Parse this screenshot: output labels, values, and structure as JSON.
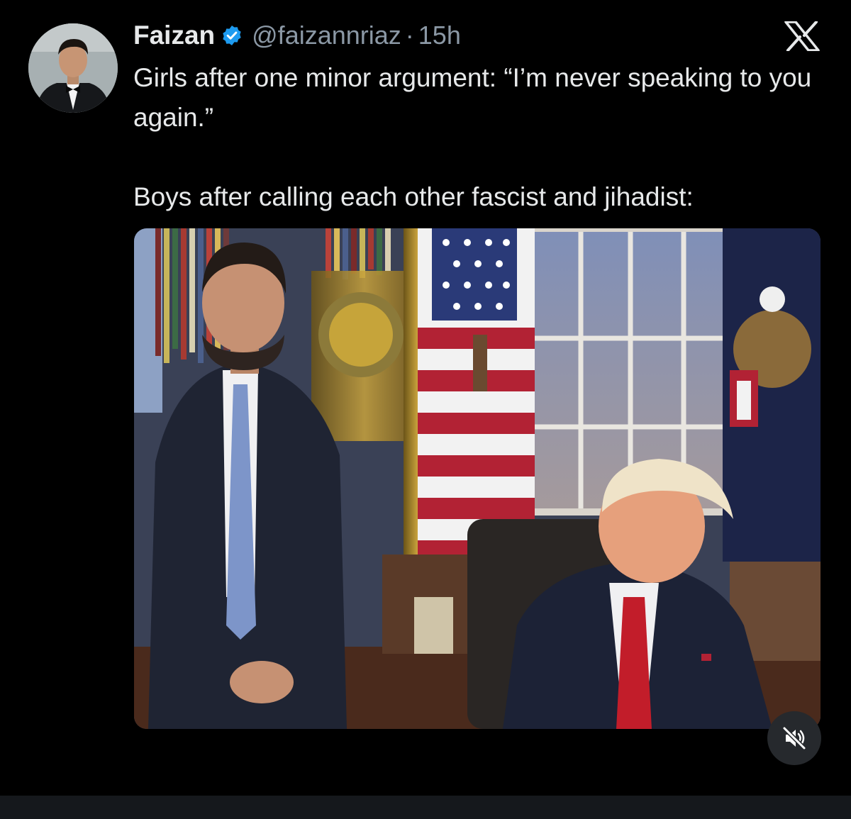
{
  "tweet": {
    "author_name": "Faizan",
    "handle": "@faizannriaz",
    "separator": "·",
    "time": "15h",
    "text_line1": "Girls after one minor argument: “I’m never speaking to you again.”",
    "text_line2": "Boys after calling each other fascist and jihadist:"
  },
  "icons": {
    "verified": "verified-badge-icon",
    "platform": "x-logo-icon",
    "mute": "speaker-muted-icon"
  },
  "colors": {
    "background": "#000000",
    "text": "#e7e9ea",
    "secondary_text": "#8b98a5",
    "verified": "#1d9bf0"
  }
}
